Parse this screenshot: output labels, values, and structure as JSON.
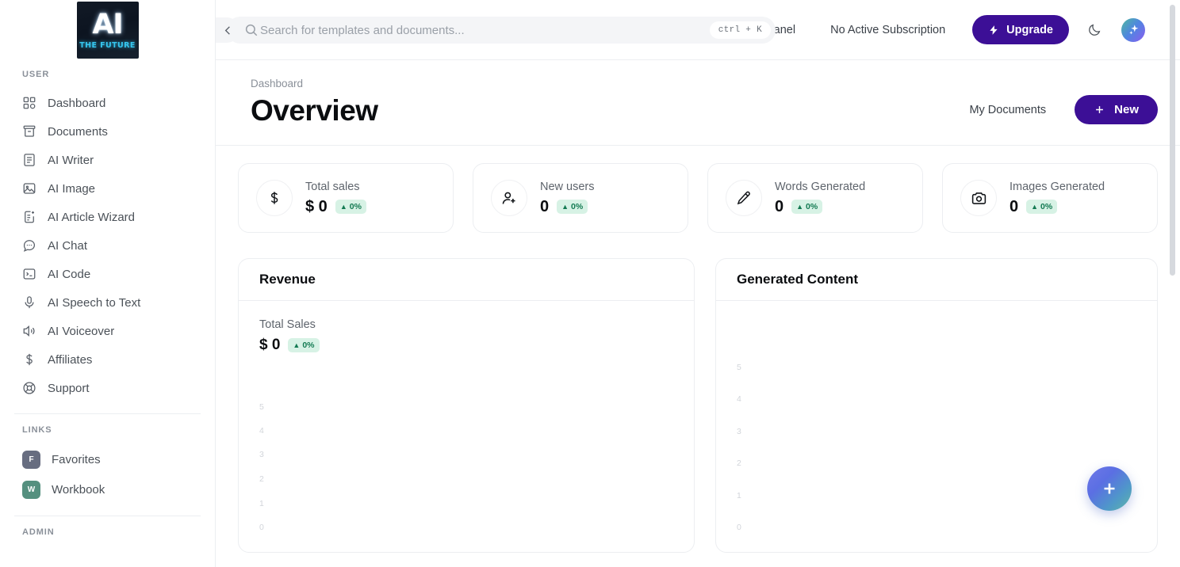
{
  "brand": {
    "logo_text": "AI",
    "logo_sub": "THE FUTURE"
  },
  "sidebar": {
    "section_user": "USER",
    "user_items": [
      {
        "label": "Dashboard",
        "icon": "grid-icon"
      },
      {
        "label": "Documents",
        "icon": "archive-icon"
      },
      {
        "label": "AI Writer",
        "icon": "document-text-icon"
      },
      {
        "label": "AI Image",
        "icon": "image-icon"
      },
      {
        "label": "AI Article Wizard",
        "icon": "article-wizard-icon"
      },
      {
        "label": "AI Chat",
        "icon": "chat-bubble-icon"
      },
      {
        "label": "AI Code",
        "icon": "terminal-icon"
      },
      {
        "label": "AI Speech to Text",
        "icon": "microphone-icon"
      },
      {
        "label": "AI Voiceover",
        "icon": "speaker-icon"
      },
      {
        "label": "Affiliates",
        "icon": "dollar-icon"
      },
      {
        "label": "Support",
        "icon": "lifebuoy-icon"
      }
    ],
    "section_links": "LINKS",
    "links": [
      {
        "label": "Favorites",
        "initial": "F",
        "color": "#676d80"
      },
      {
        "label": "Workbook",
        "initial": "W",
        "color": "#55907f"
      }
    ],
    "section_admin": "ADMIN"
  },
  "topbar": {
    "collapse_icon": "chevron-left-icon",
    "search": {
      "icon": "search-icon",
      "placeholder": "Search for templates and documents...",
      "value": "",
      "shortcut": "ctrl + K"
    },
    "admin_panel": "Admin Panel",
    "subscription": "No Active Subscription",
    "upgrade": "Upgrade",
    "theme_toggle_icon": "moon-icon",
    "avatar_icon": "sparkle-icon"
  },
  "page": {
    "breadcrumb": "Dashboard",
    "title": "Overview",
    "my_documents": "My Documents",
    "new_button": "New"
  },
  "stats": [
    {
      "label": "Total sales",
      "value": "$ 0",
      "delta": "0%",
      "icon": "dollar-icon"
    },
    {
      "label": "New users",
      "value": "0",
      "delta": "0%",
      "icon": "user-plus-icon"
    },
    {
      "label": "Words Generated",
      "value": "0",
      "delta": "0%",
      "icon": "pencil-icon"
    },
    {
      "label": "Images Generated",
      "value": "0",
      "delta": "0%",
      "icon": "camera-icon"
    }
  ],
  "revenue_panel": {
    "title": "Revenue",
    "sub_label": "Total Sales",
    "sub_value": "$ 0",
    "sub_delta": "0%"
  },
  "generated_panel": {
    "title": "Generated Content",
    "fab_icon": "plus-icon"
  },
  "colors": {
    "accent_purple": "#3c0f96",
    "chip_bg": "#d7f2e5",
    "chip_text": "#137a52",
    "logo_cyan": "#35c6ef"
  },
  "chart_data": [
    {
      "type": "line",
      "title": "Revenue",
      "subtitle": "Total Sales",
      "xlabel": "",
      "ylabel": "",
      "categories": [],
      "values": [],
      "yticks": [
        "5",
        "4",
        "3",
        "2",
        "1",
        "0"
      ],
      "ylim": [
        0,
        5
      ],
      "grid": false,
      "legend": "none",
      "annotations": [
        "$ 0",
        "0%"
      ]
    },
    {
      "type": "line",
      "title": "Generated Content",
      "subtitle": "",
      "xlabel": "",
      "ylabel": "",
      "categories": [],
      "values": [],
      "yticks": [
        "5",
        "4",
        "3",
        "2",
        "1",
        "0"
      ],
      "ylim": [
        0,
        5
      ],
      "grid": false,
      "legend": "none",
      "annotations": []
    }
  ]
}
